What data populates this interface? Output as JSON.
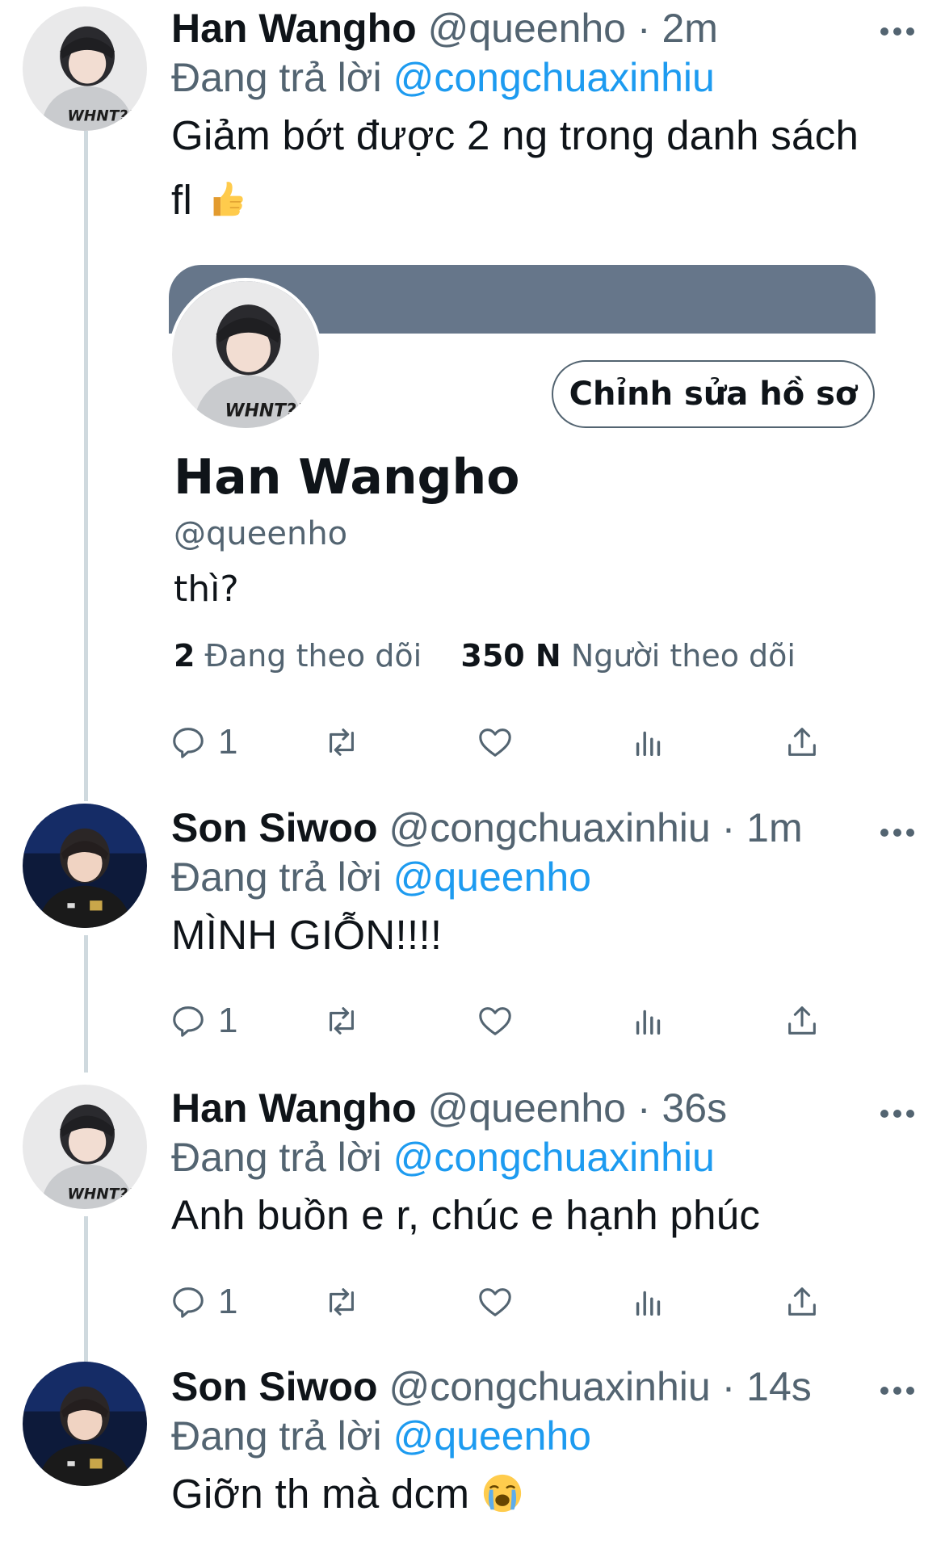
{
  "tweets": [
    {
      "name": "Han Wangho",
      "handle": "@queenho",
      "time": "· 2m",
      "reply_prefix": "Đang trả lời",
      "reply_to": "@congchuaxinhiu",
      "text_line1": "Giảm bớt được 2 ng trong danh sách",
      "text_line2": "fl",
      "emoji": "thumbs-up",
      "reply_count": "1"
    },
    {
      "name": "Son Siwoo",
      "handle": "@congchuaxinhiu",
      "time": "· 1m",
      "reply_prefix": "Đang trả lời",
      "reply_to": "@queenho",
      "text": "MÌNH GIỖN!!!!",
      "reply_count": "1"
    },
    {
      "name": "Han Wangho",
      "handle": "@queenho",
      "time": "· 36s",
      "reply_prefix": "Đang trả lời",
      "reply_to": "@congchuaxinhiu",
      "text": "Anh buồn e r, chúc e hạnh phúc",
      "reply_count": "1"
    },
    {
      "name": "Son Siwoo",
      "handle": "@congchuaxinhiu",
      "time": "· 14s",
      "reply_prefix": "Đang trả lời",
      "reply_to": "@queenho",
      "text": "Giỡn th mà dcm",
      "emoji": "loudly-crying-face"
    }
  ],
  "profile_card": {
    "name": "Han Wangho",
    "handle": "@queenho",
    "bio": "thì?",
    "edit_button": "Chỉnh sửa hồ sơ",
    "following_count": "2",
    "following_label": "Đang theo dõi",
    "followers_count": "350 N",
    "followers_label": "Người theo dõi",
    "banner_color": "#66768a"
  },
  "colors": {
    "accent": "#1d9bf0",
    "muted": "#536471",
    "thread_line": "#cfd9de"
  },
  "icons": [
    "reply-icon",
    "retweet-icon",
    "like-icon",
    "analytics-icon",
    "share-icon",
    "more-icon"
  ]
}
